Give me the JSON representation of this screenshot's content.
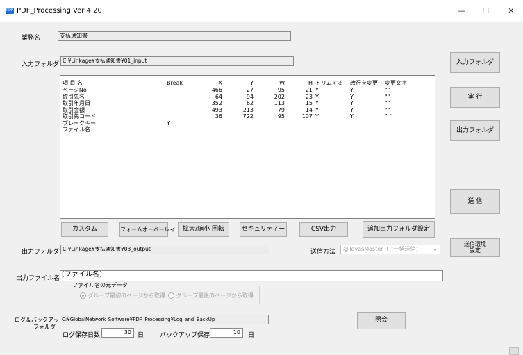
{
  "window": {
    "title": "PDF_Processing Ver 4.20",
    "minimize": "—",
    "maximize": "☐",
    "close": "✕"
  },
  "labels": {
    "business_name": "業務名",
    "input_folder": "入力フォルダ",
    "output_folder": "出力フォルダ",
    "output_file_name": "出力ファイル名",
    "send_method": "送信方法",
    "filename_source_group": "ファイル名の元データ",
    "log_backup_line1": "ログ＆バックアップ",
    "log_backup_line2": "フォルダ",
    "log_days": "ログ保存日数",
    "backup_days": "バックアップ保存日数",
    "day_unit": "日"
  },
  "fields": {
    "business_name": "支払通知書",
    "input_folder": "C:¥Linkage¥支払通知書¥01_input",
    "output_folder": "C:¥Linkage¥支払通知書¥03_output",
    "output_file_name": "[ファイル名]",
    "log_backup_folder": "C:¥GlobalNetwork_Software¥PDF_Processing¥Log_and_BackUp",
    "log_days": "30",
    "backup_days": "10",
    "send_method": "@TovasMaster + (一括送信)"
  },
  "radio": {
    "first_page": "グループ最初のページから取得",
    "last_page": "グループ最後のページから取得"
  },
  "table": {
    "headers": [
      "項 目 名",
      "Break",
      "X",
      "Y",
      "W",
      "H",
      "トリムする",
      "改行を変更",
      "変更文字"
    ],
    "rows": [
      [
        "ページNo",
        "",
        "466",
        "27",
        "95",
        "21",
        "Y",
        "Y",
        "\"\""
      ],
      [
        "取引先名",
        "",
        "64",
        "94",
        "202",
        "23",
        "Y",
        "Y",
        "\"\""
      ],
      [
        "取引年月日",
        "",
        "352",
        "62",
        "113",
        "15",
        "Y",
        "Y",
        "\"\""
      ],
      [
        "取引金額",
        "",
        "493",
        "213",
        "79",
        "14",
        "Y",
        "Y",
        "\"\""
      ],
      [
        "取引先コード",
        "",
        "36",
        "722",
        "95",
        "107",
        "Y",
        "Y",
        "\" \""
      ],
      [
        "ブレークキー",
        "Y",
        "",
        "",
        "",
        "",
        "",
        "",
        ""
      ],
      [
        "ファイル名",
        "",
        "",
        "",
        "",
        "",
        "",
        "",
        ""
      ]
    ]
  },
  "buttons": {
    "custom": "カスタム",
    "form_overlay": "フォームオーバーレイ",
    "zoom_rotate": "拡大/縮小 回転",
    "security": "セキュリティー",
    "csv_output": "CSV出力",
    "extra_output_folder": "追加出力フォルダ設定",
    "input_folder": "入力フォルダ",
    "execute": "実 行",
    "output_folder": "出力フォルダ",
    "send": "送 信",
    "send_env_line1": "送信環境",
    "send_env_line2": "設定",
    "inquiry": "照会"
  }
}
